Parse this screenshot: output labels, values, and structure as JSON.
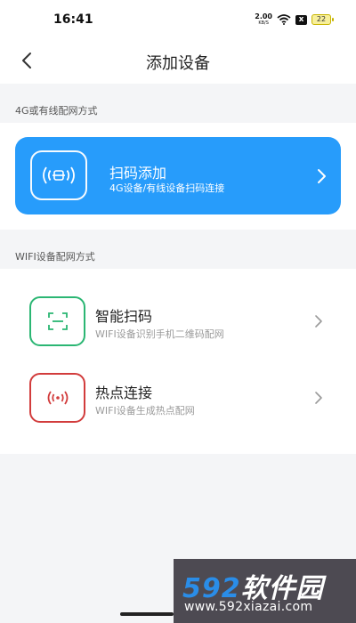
{
  "status_bar": {
    "time": "16:41",
    "net_speed_value": "2.00",
    "net_speed_unit": "KB/S",
    "sim_label": "x",
    "battery": "22"
  },
  "header": {
    "title": "添加设备"
  },
  "section_4g": {
    "label": "4G或有线配网方式",
    "card": {
      "title": "扫码添加",
      "subtitle": "4G设备/有线设备扫码连接"
    }
  },
  "section_wifi": {
    "label": "WIFI设备配网方式",
    "items": [
      {
        "title": "智能扫码",
        "subtitle": "WIFI设备识别手机二维码配网",
        "icon": "scan-frame-icon",
        "color": "#2bb673"
      },
      {
        "title": "热点连接",
        "subtitle": "WIFI设备生成热点配网",
        "icon": "hotspot-icon",
        "color": "#d23c3c"
      }
    ]
  },
  "watermark": {
    "logo_num": "592",
    "logo_text": "软件园",
    "url": "www.592xiazai.com"
  },
  "colors": {
    "accent": "#279cfb",
    "green": "#2bb673",
    "red": "#d23c3c",
    "background": "#f4f5f7"
  }
}
